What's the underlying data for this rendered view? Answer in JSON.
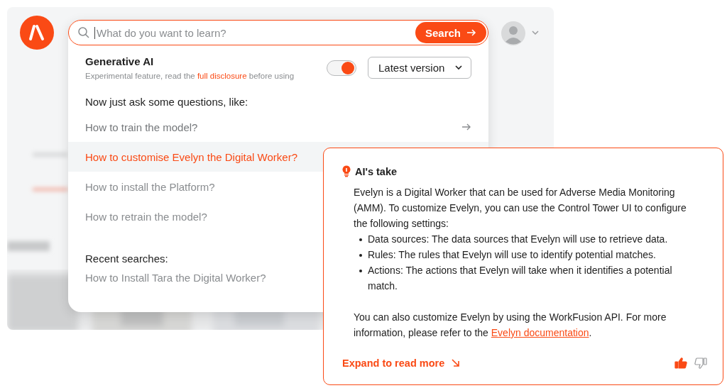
{
  "search": {
    "placeholder": "What do you want to learn?",
    "button": "Search"
  },
  "generative_ai": {
    "title": "Generative AI",
    "description": "Experimental feature, read the ",
    "disclosure_link": "full disclosure",
    "description_end": " before using",
    "on": true,
    "version": "Latest version"
  },
  "suggestions": {
    "heading": "Now just ask some questions, like:",
    "items": [
      {
        "label": "How to train the model?",
        "selected": false,
        "hovered": true
      },
      {
        "label": "How to customise Evelyn the Digital Worker?",
        "selected": true,
        "hovered": false
      },
      {
        "label": "How to install the Platform?",
        "selected": false,
        "hovered": false
      },
      {
        "label": "How to retrain the model?",
        "selected": false,
        "hovered": false
      }
    ]
  },
  "recent": {
    "heading": "Recent searches:",
    "items": [
      "How to Install Tara the Digital Worker?"
    ]
  },
  "ai_take": {
    "title": "AI's take",
    "intro": "Evelyn is a Digital Worker that can be used for Adverse Media Monitoring (AMM). To customize Evelyn, you can use the Control Tower UI to configure the following settings:",
    "bullets": [
      "Data sources: The data sources that Evelyn will use to retrieve data.",
      "Rules: The rules that Evelyn will use to identify potential matches.",
      "Actions: The actions that Evelyn will take when it identifies a potential match."
    ],
    "outro": "You can also customize Evelyn by using the WorkFusion API. For more information, please refer to the ",
    "outro_link": "Evelyn documentation",
    "outro_end": ".",
    "expand": "Expand to read more",
    "liked": true,
    "disliked": false
  }
}
